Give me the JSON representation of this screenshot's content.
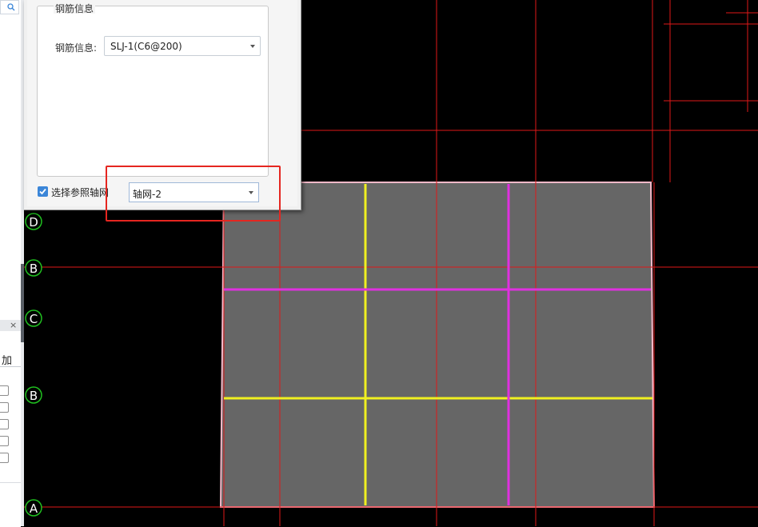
{
  "dialog": {
    "group_title": "钢筋信息",
    "rebar_label": "钢筋信息:",
    "rebar_value": "SLJ-1(C6@200)",
    "ref_checkbox_label": "选择参照轴网",
    "ref_checkbox_checked": true,
    "grid_value": "轴网-2"
  },
  "left_panel": {
    "bottom_header_text": "加",
    "close_icon": "close-icon",
    "search_icon": "search-icon"
  },
  "canvas": {
    "axis_labels": [
      "D",
      "B",
      "C",
      "B",
      "A"
    ]
  },
  "colors": {
    "background": "#000000",
    "slab_fill": "#666666",
    "grid_red": "#e01818",
    "rebar_yellow": "#f0f020",
    "rebar_magenta": "#e030e0",
    "slab_outline": "#f4b8c8",
    "axis_bubble": "#20c020",
    "highlight": "#e52620",
    "accent_blue": "#2f86e0"
  }
}
